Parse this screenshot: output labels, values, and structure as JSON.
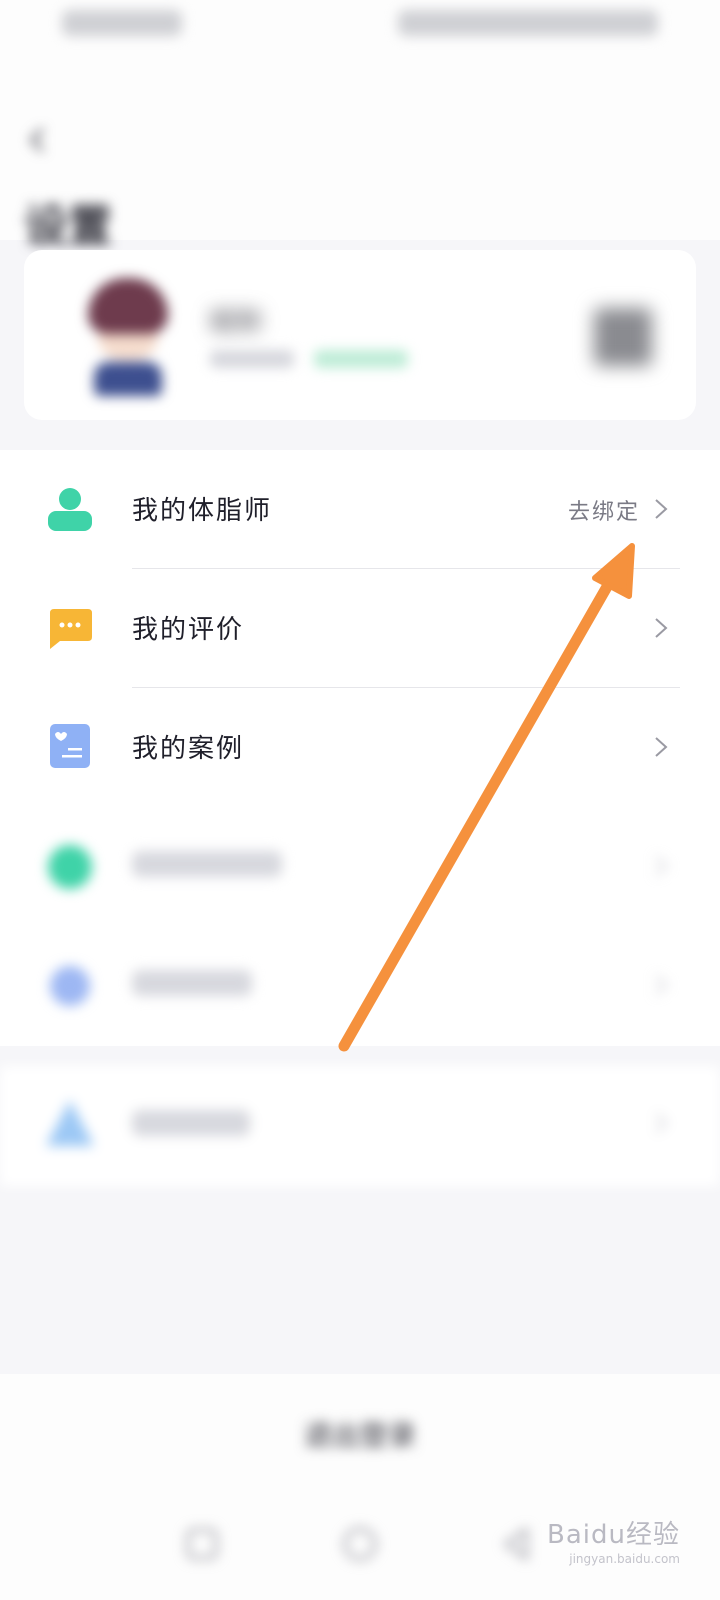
{
  "header": {
    "title": "设置"
  },
  "profile": {
    "name": "昵称"
  },
  "settings": {
    "items": [
      {
        "label": "我的体脂师",
        "value": "去绑定",
        "icon": "person-icon"
      },
      {
        "label": "我的评价",
        "value": "",
        "icon": "chat-bubble-icon"
      },
      {
        "label": "我的案例",
        "value": "",
        "icon": "case-card-icon"
      },
      {
        "label": "",
        "value": "",
        "icon": "help-icon"
      },
      {
        "label": "",
        "value": "",
        "icon": "settings-icon"
      }
    ],
    "extra_item": {
      "label": "",
      "icon": "account-icon"
    }
  },
  "bottom": {
    "logout_label": "退出登录"
  },
  "watermark": {
    "text": "Baidu经验",
    "sub": "jingyan.baidu.com"
  },
  "colors": {
    "accent_green": "#3fd3a8",
    "annotation_arrow": "#f5913d",
    "chat_icon": "#f7b636",
    "case_icon": "#8fb1f5"
  }
}
